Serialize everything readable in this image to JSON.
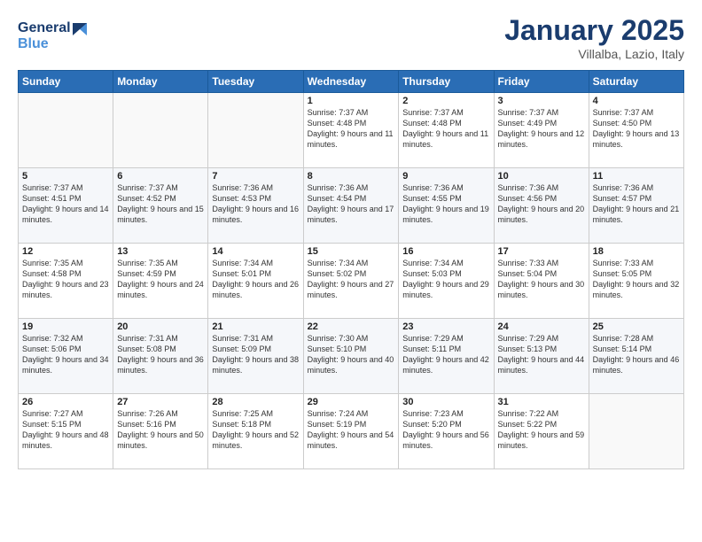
{
  "logo": {
    "line1": "General",
    "line2": "Blue"
  },
  "title": "January 2025",
  "location": "Villalba, Lazio, Italy",
  "days_header": [
    "Sunday",
    "Monday",
    "Tuesday",
    "Wednesday",
    "Thursday",
    "Friday",
    "Saturday"
  ],
  "weeks": [
    [
      {
        "day": "",
        "sunrise": "",
        "sunset": "",
        "daylight": ""
      },
      {
        "day": "",
        "sunrise": "",
        "sunset": "",
        "daylight": ""
      },
      {
        "day": "",
        "sunrise": "",
        "sunset": "",
        "daylight": ""
      },
      {
        "day": "1",
        "sunrise": "Sunrise: 7:37 AM",
        "sunset": "Sunset: 4:48 PM",
        "daylight": "Daylight: 9 hours and 11 minutes."
      },
      {
        "day": "2",
        "sunrise": "Sunrise: 7:37 AM",
        "sunset": "Sunset: 4:48 PM",
        "daylight": "Daylight: 9 hours and 11 minutes."
      },
      {
        "day": "3",
        "sunrise": "Sunrise: 7:37 AM",
        "sunset": "Sunset: 4:49 PM",
        "daylight": "Daylight: 9 hours and 12 minutes."
      },
      {
        "day": "4",
        "sunrise": "Sunrise: 7:37 AM",
        "sunset": "Sunset: 4:50 PM",
        "daylight": "Daylight: 9 hours and 13 minutes."
      }
    ],
    [
      {
        "day": "5",
        "sunrise": "Sunrise: 7:37 AM",
        "sunset": "Sunset: 4:51 PM",
        "daylight": "Daylight: 9 hours and 14 minutes."
      },
      {
        "day": "6",
        "sunrise": "Sunrise: 7:37 AM",
        "sunset": "Sunset: 4:52 PM",
        "daylight": "Daylight: 9 hours and 15 minutes."
      },
      {
        "day": "7",
        "sunrise": "Sunrise: 7:36 AM",
        "sunset": "Sunset: 4:53 PM",
        "daylight": "Daylight: 9 hours and 16 minutes."
      },
      {
        "day": "8",
        "sunrise": "Sunrise: 7:36 AM",
        "sunset": "Sunset: 4:54 PM",
        "daylight": "Daylight: 9 hours and 17 minutes."
      },
      {
        "day": "9",
        "sunrise": "Sunrise: 7:36 AM",
        "sunset": "Sunset: 4:55 PM",
        "daylight": "Daylight: 9 hours and 19 minutes."
      },
      {
        "day": "10",
        "sunrise": "Sunrise: 7:36 AM",
        "sunset": "Sunset: 4:56 PM",
        "daylight": "Daylight: 9 hours and 20 minutes."
      },
      {
        "day": "11",
        "sunrise": "Sunrise: 7:36 AM",
        "sunset": "Sunset: 4:57 PM",
        "daylight": "Daylight: 9 hours and 21 minutes."
      }
    ],
    [
      {
        "day": "12",
        "sunrise": "Sunrise: 7:35 AM",
        "sunset": "Sunset: 4:58 PM",
        "daylight": "Daylight: 9 hours and 23 minutes."
      },
      {
        "day": "13",
        "sunrise": "Sunrise: 7:35 AM",
        "sunset": "Sunset: 4:59 PM",
        "daylight": "Daylight: 9 hours and 24 minutes."
      },
      {
        "day": "14",
        "sunrise": "Sunrise: 7:34 AM",
        "sunset": "Sunset: 5:01 PM",
        "daylight": "Daylight: 9 hours and 26 minutes."
      },
      {
        "day": "15",
        "sunrise": "Sunrise: 7:34 AM",
        "sunset": "Sunset: 5:02 PM",
        "daylight": "Daylight: 9 hours and 27 minutes."
      },
      {
        "day": "16",
        "sunrise": "Sunrise: 7:34 AM",
        "sunset": "Sunset: 5:03 PM",
        "daylight": "Daylight: 9 hours and 29 minutes."
      },
      {
        "day": "17",
        "sunrise": "Sunrise: 7:33 AM",
        "sunset": "Sunset: 5:04 PM",
        "daylight": "Daylight: 9 hours and 30 minutes."
      },
      {
        "day": "18",
        "sunrise": "Sunrise: 7:33 AM",
        "sunset": "Sunset: 5:05 PM",
        "daylight": "Daylight: 9 hours and 32 minutes."
      }
    ],
    [
      {
        "day": "19",
        "sunrise": "Sunrise: 7:32 AM",
        "sunset": "Sunset: 5:06 PM",
        "daylight": "Daylight: 9 hours and 34 minutes."
      },
      {
        "day": "20",
        "sunrise": "Sunrise: 7:31 AM",
        "sunset": "Sunset: 5:08 PM",
        "daylight": "Daylight: 9 hours and 36 minutes."
      },
      {
        "day": "21",
        "sunrise": "Sunrise: 7:31 AM",
        "sunset": "Sunset: 5:09 PM",
        "daylight": "Daylight: 9 hours and 38 minutes."
      },
      {
        "day": "22",
        "sunrise": "Sunrise: 7:30 AM",
        "sunset": "Sunset: 5:10 PM",
        "daylight": "Daylight: 9 hours and 40 minutes."
      },
      {
        "day": "23",
        "sunrise": "Sunrise: 7:29 AM",
        "sunset": "Sunset: 5:11 PM",
        "daylight": "Daylight: 9 hours and 42 minutes."
      },
      {
        "day": "24",
        "sunrise": "Sunrise: 7:29 AM",
        "sunset": "Sunset: 5:13 PM",
        "daylight": "Daylight: 9 hours and 44 minutes."
      },
      {
        "day": "25",
        "sunrise": "Sunrise: 7:28 AM",
        "sunset": "Sunset: 5:14 PM",
        "daylight": "Daylight: 9 hours and 46 minutes."
      }
    ],
    [
      {
        "day": "26",
        "sunrise": "Sunrise: 7:27 AM",
        "sunset": "Sunset: 5:15 PM",
        "daylight": "Daylight: 9 hours and 48 minutes."
      },
      {
        "day": "27",
        "sunrise": "Sunrise: 7:26 AM",
        "sunset": "Sunset: 5:16 PM",
        "daylight": "Daylight: 9 hours and 50 minutes."
      },
      {
        "day": "28",
        "sunrise": "Sunrise: 7:25 AM",
        "sunset": "Sunset: 5:18 PM",
        "daylight": "Daylight: 9 hours and 52 minutes."
      },
      {
        "day": "29",
        "sunrise": "Sunrise: 7:24 AM",
        "sunset": "Sunset: 5:19 PM",
        "daylight": "Daylight: 9 hours and 54 minutes."
      },
      {
        "day": "30",
        "sunrise": "Sunrise: 7:23 AM",
        "sunset": "Sunset: 5:20 PM",
        "daylight": "Daylight: 9 hours and 56 minutes."
      },
      {
        "day": "31",
        "sunrise": "Sunrise: 7:22 AM",
        "sunset": "Sunset: 5:22 PM",
        "daylight": "Daylight: 9 hours and 59 minutes."
      },
      {
        "day": "",
        "sunrise": "",
        "sunset": "",
        "daylight": ""
      }
    ]
  ]
}
